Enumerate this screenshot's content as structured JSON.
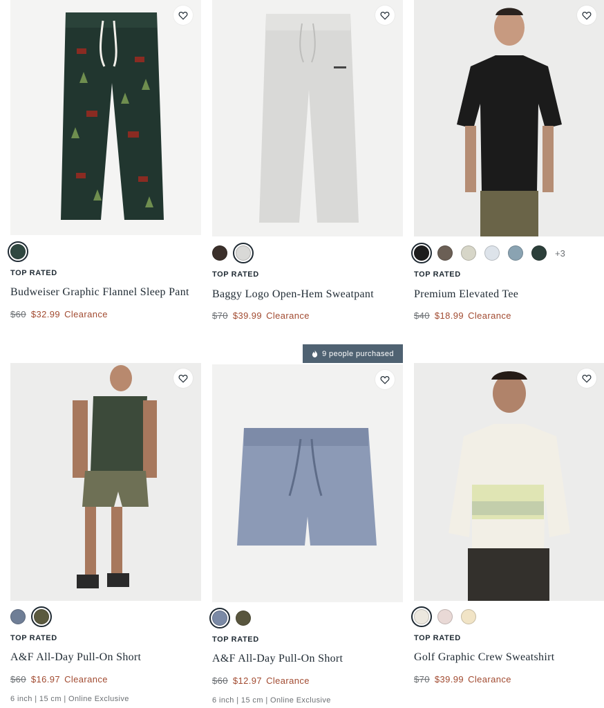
{
  "products": [
    {
      "badge": "TOP RATED",
      "name": "Budweiser Graphic Flannel Sleep Pant",
      "was_price": "$60",
      "sale_price": "$32.99",
      "sale_tag": "Clearance",
      "swatches": [
        "#2f4740"
      ]
    },
    {
      "badge": "",
      "name": "Baggy Logo Open-Hem Sweatpant",
      "was_price": "$70",
      "sale_price": "$39.99",
      "sale_tag": "Clearance",
      "swatches": [
        "#3b302b",
        "#d9d9d7"
      ]
    },
    {
      "badge": "TOP RATED",
      "name": "Premium Elevated Tee",
      "was_price": "$40",
      "sale_price": "$18.99",
      "sale_tag": "Clearance",
      "swatches": [
        "#1c1c1c",
        "#6b5f55",
        "#d7d6c8",
        "#dde3ea",
        "#8aa3b2",
        "#2c3f3a"
      ],
      "more_swatches": "+3"
    },
    {
      "badge": "TOP RATED",
      "name": "A&F All-Day Pull-On Short",
      "was_price": "$60",
      "sale_price": "$16.97",
      "sale_tag": "Clearance",
      "note": "6 inch | 15 cm | Online Exclusive",
      "swatches": [
        "#6f7e96",
        "#5b5a3f"
      ]
    },
    {
      "badge": "TOP RATED",
      "name": "A&F All-Day Pull-On Short",
      "was_price": "$60",
      "sale_price": "$12.97",
      "sale_tag": "Clearance",
      "note": "6 inch | 15 cm | Online Exclusive",
      "purchased_banner": "9 people purchased",
      "swatches": [
        "#7b8aa6",
        "#59563e"
      ]
    },
    {
      "badge": "TOP RATED",
      "name": "Golf Graphic Crew Sweatshirt",
      "was_price": "$70",
      "sale_price": "$39.99",
      "sale_tag": "Clearance",
      "swatches": [
        "#ece8df",
        "#e9d9d6",
        "#f1e4c6"
      ]
    }
  ],
  "icons": {
    "favorite": "heart-outline-icon",
    "purchased": "flame-icon"
  },
  "colors": {
    "sale_red": "#a14a30",
    "banner_blue": "#4f6272",
    "text_dark": "#1f2a33"
  }
}
